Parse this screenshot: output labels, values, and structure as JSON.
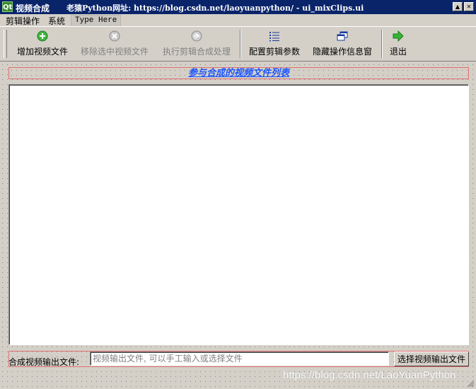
{
  "window": {
    "app_title": "视频合成",
    "title_detail": "老猿Python网址: https://blog.csdn.net/laoyuanpython/ - ui_mixClips.ui",
    "logo_text": "Qt",
    "min_glyph": "▲",
    "close_glyph": "✕"
  },
  "menu": {
    "items": [
      "剪辑操作",
      "系统"
    ],
    "type_here": "Type Here"
  },
  "toolbar": {
    "add": {
      "label": "增加视频文件",
      "icon": "plus-circle-icon",
      "color": "#2e9e2e"
    },
    "remove": {
      "label": "移除选中视频文件",
      "icon": "remove-circle-icon"
    },
    "execute": {
      "label": "执行剪辑合成处理",
      "icon": "process-icon"
    },
    "config": {
      "label": "配置剪辑参数",
      "icon": "list-icon",
      "color": "#1a3a9e"
    },
    "hide": {
      "label": "隐藏操作信息窗",
      "icon": "windows-icon",
      "color": "#1a3a9e"
    },
    "exit": {
      "label": "退出",
      "icon": "right-arrow-icon",
      "color": "#2aa02a"
    }
  },
  "list": {
    "title": "参与合成的视频文件列表",
    "title_color": "#1a55ff"
  },
  "output": {
    "label": "合成视频输出文件:",
    "placeholder": "视频输出文件, 可以手工输入或选择文件",
    "value": "",
    "button": "选择视频输出文件"
  },
  "watermark": "https://blog.csdn.net/LaoYuanPython"
}
